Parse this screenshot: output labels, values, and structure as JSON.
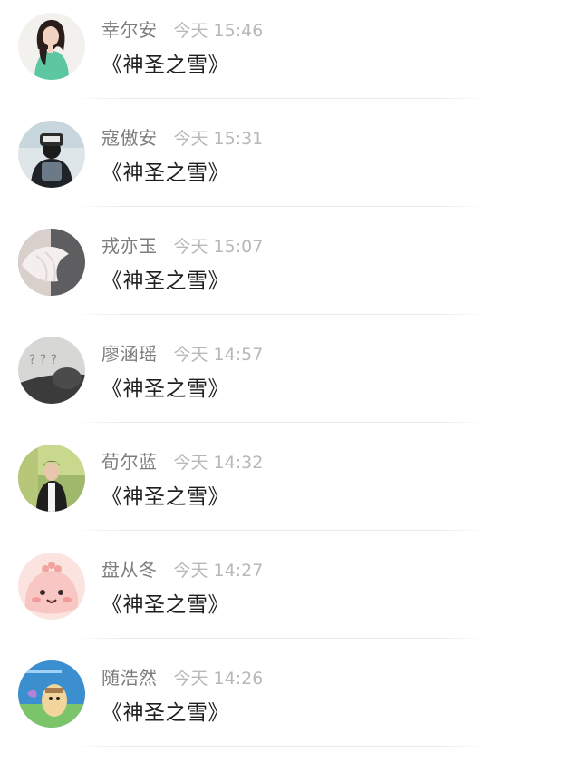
{
  "messages": [
    {
      "name": "幸尔安",
      "time": "今天 15:46",
      "text": "《神圣之雪》",
      "avatar": "girl-green-shirt-avatar"
    },
    {
      "name": "寇傲安",
      "time": "今天 15:31",
      "text": "《神圣之雪》",
      "avatar": "boy-cap-backpack-avatar"
    },
    {
      "name": "戎亦玉",
      "time": "今天 15:07",
      "text": "《神圣之雪》",
      "avatar": "white-fish-fin-avatar"
    },
    {
      "name": "廖涵瑶",
      "time": "今天 14:57",
      "text": "《神圣之雪》",
      "avatar": "cat-question-marks-avatar"
    },
    {
      "name": "荀尔蓝",
      "time": "今天 14:32",
      "text": "《神圣之雪》",
      "avatar": "boy-outdoor-avatar"
    },
    {
      "name": "盘从冬",
      "time": "今天 14:27",
      "text": "《神圣之雪》",
      "avatar": "pink-cartoon-blob-avatar"
    },
    {
      "name": "随浩然",
      "time": "今天 14:26",
      "text": "《神圣之雪》",
      "avatar": "cartoon-character-avatar"
    }
  ]
}
